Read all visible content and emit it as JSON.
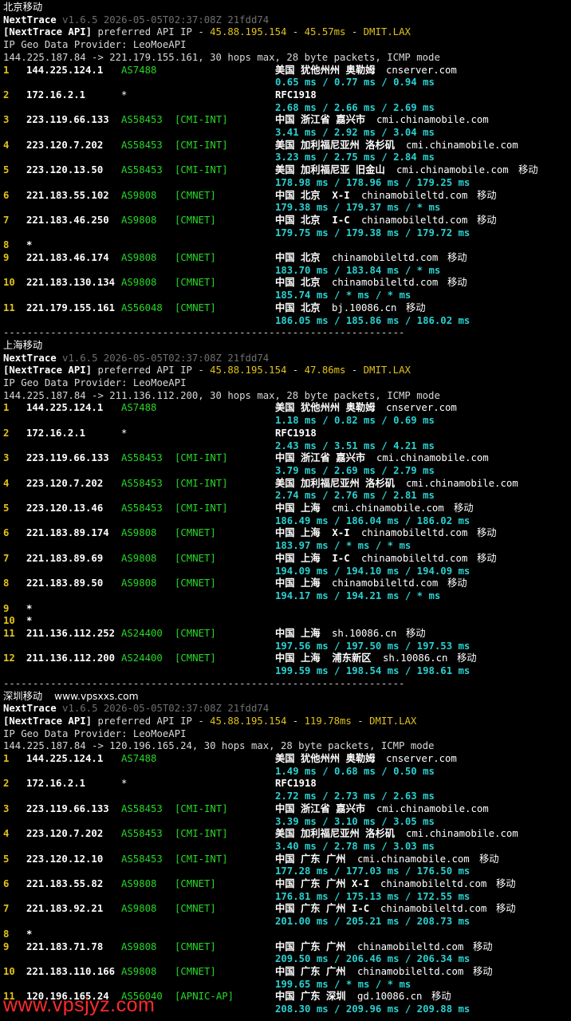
{
  "separator": "--------------------------------------------------------------------",
  "sections": [
    {
      "title": "北京移动",
      "header": {
        "app": "NextTrace",
        "version": "v1.6.5 2026-05-05T02:37:08Z 21fdd74",
        "api_tag": "[NextTrace API]",
        "api_text": " preferred API IP - ",
        "api_ip": "45.88.195.154",
        "api_dash": " - ",
        "api_ms": "45.57ms",
        "api_dash2": " - ",
        "api_loc": "DMIT.LAX",
        "geo": "IP Geo Data Provider: LeoMoeAPI",
        "route": "144.225.187.84 -> 221.179.155.161, 30 hops max, 28 byte packets, ICMP mode"
      },
      "hops": [
        {
          "n": "1",
          "ip": "144.225.124.1",
          "as": "AS7488",
          "tag": "",
          "geo": "美国 犹他州州 奥勒姆",
          "domain": "cnserver.com",
          "isp": "",
          "rtt": "0.65 ms / 0.77 ms / 0.94 ms"
        },
        {
          "n": "2",
          "ip": "172.16.2.1",
          "as": "*",
          "tag": "",
          "geo": "RFC1918",
          "domain": "",
          "isp": "",
          "rtt": "2.68 ms / 2.66 ms / 2.69 ms"
        },
        {
          "n": "3",
          "ip": "223.119.66.133",
          "as": "AS58453",
          "tag": "[CMI-INT]",
          "geo": "中国 浙江省 嘉兴市",
          "domain": "cmi.chinamobile.com",
          "isp": "",
          "rtt": "3.41 ms / 2.92 ms / 3.04 ms"
        },
        {
          "n": "4",
          "ip": "223.120.7.202",
          "as": "AS58453",
          "tag": "[CMI-INT]",
          "geo": "美国 加利福尼亚州 洛杉矶",
          "domain": "cmi.chinamobile.com",
          "isp": "",
          "rtt": "3.23 ms / 2.75 ms / 2.84 ms"
        },
        {
          "n": "5",
          "ip": "223.120.13.50",
          "as": "AS58453",
          "tag": "[CMI-INT]",
          "geo": "美国 加利福尼亚 旧金山",
          "domain": "cmi.chinamobile.com",
          "isp": "移动",
          "rtt": "178.98 ms / 178.96 ms / 179.25 ms"
        },
        {
          "n": "6",
          "ip": "221.183.55.102",
          "as": "AS9808",
          "tag": "[CMNET]",
          "geo": "中国 北京  X-I",
          "domain": "chinamobileltd.com",
          "isp": "移动",
          "rtt": "179.38 ms / 179.37 ms / * ms"
        },
        {
          "n": "7",
          "ip": "221.183.46.250",
          "as": "AS9808",
          "tag": "[CMNET]",
          "geo": "中国 北京  I-C",
          "domain": "chinamobileltd.com",
          "isp": "移动",
          "rtt": "179.75 ms / 179.38 ms / 179.72 ms"
        },
        {
          "n": "8",
          "star": "*"
        },
        {
          "n": "9",
          "ip": "221.183.46.174",
          "as": "AS9808",
          "tag": "[CMNET]",
          "geo": "中国 北京",
          "domain": "chinamobileltd.com",
          "isp": "移动",
          "rtt": "183.70 ms / 183.84 ms / * ms"
        },
        {
          "n": "10",
          "ip": "221.183.130.134",
          "as": "AS9808",
          "tag": "[CMNET]",
          "geo": "中国 北京",
          "domain": "chinamobileltd.com",
          "isp": "移动",
          "rtt": "185.74 ms / * ms / * ms"
        },
        {
          "n": "11",
          "ip": "221.179.155.161",
          "as": "AS56048",
          "tag": "[CMNET]",
          "geo": "中国 北京",
          "domain": "bj.10086.cn",
          "isp": "移动",
          "rtt": "186.05 ms / 185.86 ms / 186.02 ms"
        }
      ]
    },
    {
      "title": "上海移动",
      "header": {
        "app": "NextTrace",
        "version": "v1.6.5 2026-05-05T02:37:08Z 21fdd74",
        "api_tag": "[NextTrace API]",
        "api_text": " preferred API IP - ",
        "api_ip": "45.88.195.154",
        "api_dash": " - ",
        "api_ms": "47.86ms",
        "api_dash2": " - ",
        "api_loc": "DMIT.LAX",
        "geo": "IP Geo Data Provider: LeoMoeAPI",
        "route": "144.225.187.84 -> 211.136.112.200, 30 hops max, 28 byte packets, ICMP mode"
      },
      "hops": [
        {
          "n": "1",
          "ip": "144.225.124.1",
          "as": "AS7488",
          "tag": "",
          "geo": "美国 犹他州州 奥勒姆",
          "domain": "cnserver.com",
          "isp": "",
          "rtt": "1.18 ms / 0.82 ms / 0.69 ms"
        },
        {
          "n": "2",
          "ip": "172.16.2.1",
          "as": "*",
          "tag": "",
          "geo": "RFC1918",
          "domain": "",
          "isp": "",
          "rtt": "2.43 ms / 3.51 ms / 4.21 ms"
        },
        {
          "n": "3",
          "ip": "223.119.66.133",
          "as": "AS58453",
          "tag": "[CMI-INT]",
          "geo": "中国 浙江省 嘉兴市",
          "domain": "cmi.chinamobile.com",
          "isp": "",
          "rtt": "3.79 ms / 2.69 ms / 2.79 ms"
        },
        {
          "n": "4",
          "ip": "223.120.7.202",
          "as": "AS58453",
          "tag": "[CMI-INT]",
          "geo": "美国 加利福尼亚州 洛杉矶",
          "domain": "cmi.chinamobile.com",
          "isp": "",
          "rtt": "2.74 ms / 2.76 ms / 2.81 ms"
        },
        {
          "n": "5",
          "ip": "223.120.13.46",
          "as": "AS58453",
          "tag": "[CMI-INT]",
          "geo": "中国 上海",
          "domain": "cmi.chinamobile.com",
          "isp": "移动",
          "rtt": "186.49 ms / 186.04 ms / 186.02 ms"
        },
        {
          "n": "6",
          "ip": "221.183.89.174",
          "as": "AS9808",
          "tag": "[CMNET]",
          "geo": "中国 上海  X-I",
          "domain": "chinamobileltd.com",
          "isp": "移动",
          "rtt": "183.97 ms / * ms / * ms"
        },
        {
          "n": "7",
          "ip": "221.183.89.69",
          "as": "AS9808",
          "tag": "[CMNET]",
          "geo": "中国 上海  I-C",
          "domain": "chinamobileltd.com",
          "isp": "移动",
          "rtt": "194.09 ms / 194.10 ms / 194.09 ms"
        },
        {
          "n": "8",
          "ip": "221.183.89.50",
          "as": "AS9808",
          "tag": "[CMNET]",
          "geo": "中国 上海",
          "domain": "chinamobileltd.com",
          "isp": "移动",
          "rtt": "194.17 ms / 194.21 ms / * ms"
        },
        {
          "n": "9",
          "star": "*"
        },
        {
          "n": "10",
          "star": "*"
        },
        {
          "n": "11",
          "ip": "211.136.112.252",
          "as": "AS24400",
          "tag": "[CMNET]",
          "geo": "中国 上海",
          "domain": "sh.10086.cn",
          "isp": "移动",
          "rtt": "197.56 ms / 197.50 ms / 197.53 ms"
        },
        {
          "n": "12",
          "ip": "211.136.112.200",
          "as": "AS24400",
          "tag": "[CMNET]",
          "geo": "中国 上海  浦东新区",
          "domain": "sh.10086.cn",
          "isp": "移动",
          "rtt": "199.59 ms / 198.54 ms / 198.61 ms"
        }
      ]
    },
    {
      "title": "深圳移动",
      "site": "www.vpsxxs.com",
      "header": {
        "app": "NextTrace",
        "version": "v1.6.5 2026-05-05T02:37:08Z 21fdd74",
        "api_tag": "[NextTrace API]",
        "api_text": " preferred API IP - ",
        "api_ip": "45.88.195.154",
        "api_dash": " - ",
        "api_ms": "119.78ms",
        "api_dash2": " - ",
        "api_loc": "DMIT.LAX",
        "geo": "IP Geo Data Provider: LeoMoeAPI",
        "route": "144.225.187.84 -> 120.196.165.24, 30 hops max, 28 byte packets, ICMP mode"
      },
      "hops": [
        {
          "n": "1",
          "ip": "144.225.124.1",
          "as": "AS7488",
          "tag": "",
          "geo": "美国 犹他州州 奥勒姆",
          "domain": "cnserver.com",
          "isp": "",
          "rtt": "1.49 ms / 0.68 ms / 0.50 ms"
        },
        {
          "n": "2",
          "ip": "172.16.2.1",
          "as": "*",
          "tag": "",
          "geo": "RFC1918",
          "domain": "",
          "isp": "",
          "rtt": "2.72 ms / 2.73 ms / 2.63 ms"
        },
        {
          "n": "3",
          "ip": "223.119.66.133",
          "as": "AS58453",
          "tag": "[CMI-INT]",
          "geo": "中国 浙江省 嘉兴市",
          "domain": "cmi.chinamobile.com",
          "isp": "",
          "rtt": "3.39 ms / 3.10 ms / 3.05 ms"
        },
        {
          "n": "4",
          "ip": "223.120.7.202",
          "as": "AS58453",
          "tag": "[CMI-INT]",
          "geo": "美国 加利福尼亚州 洛杉矶",
          "domain": "cmi.chinamobile.com",
          "isp": "",
          "rtt": "3.40 ms / 2.78 ms / 3.03 ms"
        },
        {
          "n": "5",
          "ip": "223.120.12.10",
          "as": "AS58453",
          "tag": "[CMI-INT]",
          "geo": "中国 广东 广州",
          "domain": "cmi.chinamobile.com",
          "isp": "移动",
          "rtt": "177.28 ms / 177.03 ms / 176.50 ms"
        },
        {
          "n": "6",
          "ip": "221.183.55.82",
          "as": "AS9808",
          "tag": "[CMNET]",
          "geo": "中国 广东 广州 X-I",
          "domain": "chinamobileltd.com",
          "isp": "移动",
          "rtt": "176.81 ms / 175.13 ms / 172.55 ms"
        },
        {
          "n": "7",
          "ip": "221.183.92.21",
          "as": "AS9808",
          "tag": "[CMNET]",
          "geo": "中国 广东 广州 I-C",
          "domain": "chinamobileltd.com",
          "isp": "移动",
          "rtt": "201.00 ms / 205.21 ms / 208.73 ms"
        },
        {
          "n": "8",
          "star": "*"
        },
        {
          "n": "9",
          "ip": "221.183.71.78",
          "as": "AS9808",
          "tag": "[CMNET]",
          "geo": "中国 广东 广州",
          "domain": "chinamobileltd.com",
          "isp": "移动",
          "rtt": "209.50 ms / 206.46 ms / 206.34 ms"
        },
        {
          "n": "10",
          "ip": "221.183.110.166",
          "as": "AS9808",
          "tag": "[CMNET]",
          "geo": "中国 广东 广州",
          "domain": "chinamobileltd.com",
          "isp": "移动",
          "rtt": "199.65 ms / * ms / * ms"
        },
        {
          "n": "11",
          "ip": "120.196.165.24",
          "as": "AS56040",
          "tag": "[APNIC-AP]",
          "geo": "中国 广东 深圳",
          "domain": "gd.10086.cn",
          "isp": "移动",
          "rtt": "208.30 ms / 209.96 ms / 209.88 ms"
        }
      ]
    }
  ],
  "watermark": "www.vpsjyz.com"
}
